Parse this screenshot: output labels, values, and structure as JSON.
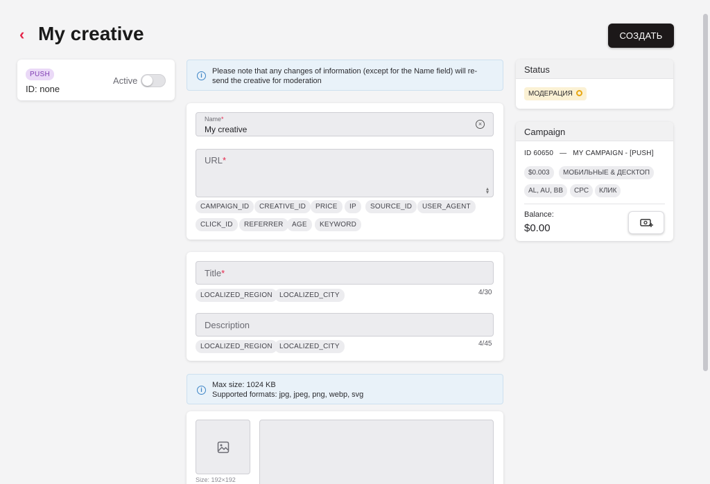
{
  "header": {
    "back_icon": "chevron-left-icon",
    "title": "My creative",
    "create_label": "СОЗДАТЬ",
    "accent_color": "#e5254a"
  },
  "creative": {
    "type_badge": "PUSH",
    "id_text": "ID: none",
    "active_label": "Active",
    "active": false
  },
  "notes": {
    "moderation": "Please note that any changes of information (except for the Name field) will re-send the creative for moderation",
    "image_max_size": "Max size: 1024 KB",
    "image_formats": "Supported formats: jpg, jpeg, png, webp, svg"
  },
  "form": {
    "name_label": "Name",
    "name_value": "My creative",
    "url_label": "URL",
    "url_macros": [
      "CAMPAIGN_ID",
      "CREATIVE_ID",
      "PRICE",
      "IP",
      "SOURCE_ID",
      "USER_AGENT",
      "CLICK_ID",
      "REFERRER",
      "AGE",
      "KEYWORD"
    ],
    "title_label": "Title",
    "title_macros": [
      "LOCALIZED_REGION",
      "LOCALIZED_CITY"
    ],
    "title_counter": "4/30",
    "description_label": "Description",
    "description_macros": [
      "LOCALIZED_REGION",
      "LOCALIZED_CITY"
    ],
    "description_counter": "4/45",
    "image_size_label": "Size: 192×192",
    "image_icon": "image-icon"
  },
  "status": {
    "header": "Status",
    "value": "МОДЕРАЦИЯ",
    "color": "#e8a712"
  },
  "campaign": {
    "header": "Campaign",
    "id_line": "ID 60650   —   MY CAMPAIGN - [PUSH]",
    "tags_row1": [
      "$0.003",
      "МОБИЛЬНЫЕ & ДЕСКТОП"
    ],
    "tags_row2": [
      "AL, AU, BB",
      "CPC",
      "КЛИК"
    ],
    "balance_label": "Balance:",
    "balance_value": "$0.00",
    "topup_icon": "money-add-icon"
  }
}
